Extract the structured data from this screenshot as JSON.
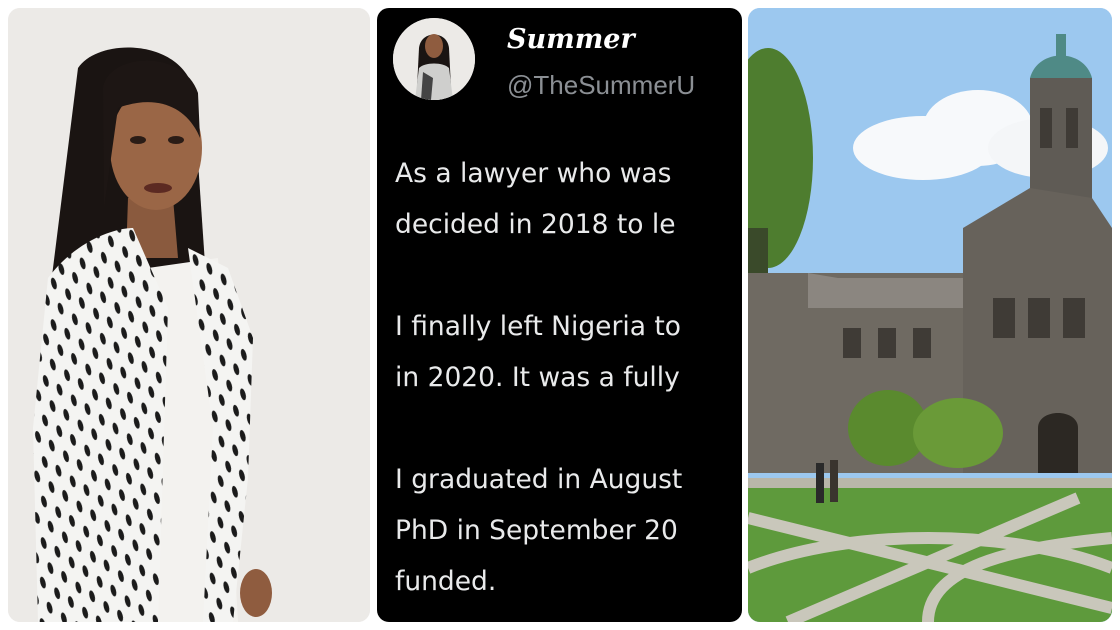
{
  "tweet": {
    "display_name": "Summer",
    "handle": "@TheSummerU",
    "paragraphs": [
      [
        "As a lawyer who was",
        "decided in 2018 to le"
      ],
      [
        "I finally left Nigeria to",
        "in 2020. It was a fully"
      ],
      [
        "I graduated in August",
        "PhD in September 20",
        "funded."
      ]
    ]
  },
  "colors": {
    "tweet_background": "#000000",
    "tweet_text": "#e9eaeb",
    "handle_text": "#8b8f94",
    "sky": "#9cc8ef",
    "lawn": "#5e9a3c"
  }
}
